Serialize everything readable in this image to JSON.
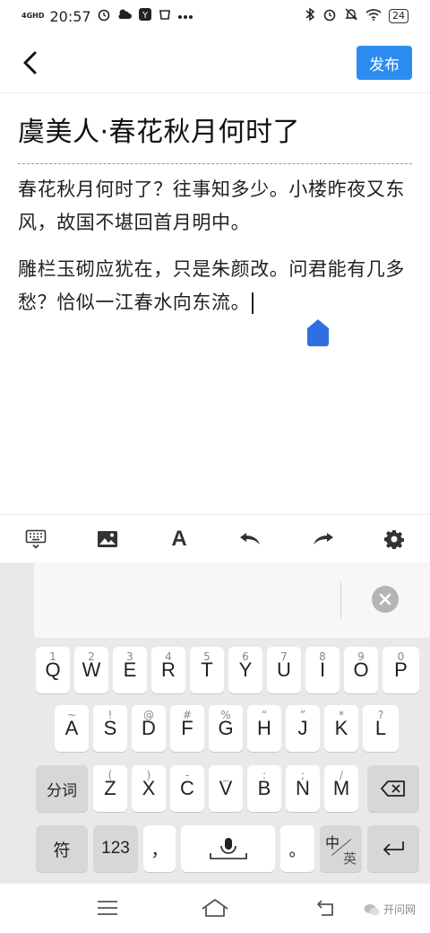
{
  "status_bar": {
    "network": "4GHD",
    "time": "20:57",
    "battery": "24"
  },
  "header": {
    "publish_label": "发布"
  },
  "editor": {
    "title": "虞美人·春花秋月何时了",
    "paragraphs": [
      "春花秋月何时了？往事知多少。小楼昨夜又东风，故国不堪回首月明中。",
      "雕栏玉砌应犹在，只是朱颜改。问君能有几多愁？恰似一江春水向东流。"
    ]
  },
  "toolbar": {
    "items": [
      "keyboard-toggle",
      "insert-image",
      "font-style",
      "undo",
      "redo",
      "settings"
    ],
    "font_label": "A"
  },
  "keyboard": {
    "row1": [
      {
        "main": "Q",
        "sub": "1"
      },
      {
        "main": "W",
        "sub": "2"
      },
      {
        "main": "E",
        "sub": "3"
      },
      {
        "main": "R",
        "sub": "4"
      },
      {
        "main": "T",
        "sub": "5"
      },
      {
        "main": "Y",
        "sub": "6"
      },
      {
        "main": "U",
        "sub": "7"
      },
      {
        "main": "I",
        "sub": "8"
      },
      {
        "main": "O",
        "sub": "9"
      },
      {
        "main": "P",
        "sub": "0"
      }
    ],
    "row2": [
      {
        "main": "A",
        "sub": "~"
      },
      {
        "main": "S",
        "sub": "!"
      },
      {
        "main": "D",
        "sub": "@"
      },
      {
        "main": "F",
        "sub": "#"
      },
      {
        "main": "G",
        "sub": "%"
      },
      {
        "main": "H",
        "sub": "“"
      },
      {
        "main": "J",
        "sub": "”"
      },
      {
        "main": "K",
        "sub": "*"
      },
      {
        "main": "L",
        "sub": "?"
      }
    ],
    "row3": [
      {
        "main": "Z",
        "sub": "("
      },
      {
        "main": "X",
        "sub": ")"
      },
      {
        "main": "C",
        "sub": "-"
      },
      {
        "main": "V",
        "sub": "_"
      },
      {
        "main": "B",
        "sub": ":"
      },
      {
        "main": "N",
        "sub": ";"
      },
      {
        "main": "M",
        "sub": "/"
      }
    ],
    "fenci_label": "分词",
    "symbol_label": "符",
    "num_label": "123",
    "comma_label": "，",
    "period_label": "。",
    "lang_zh": "中",
    "lang_en": "英",
    "colors": {
      "background": "#e9e9e9",
      "key": "#ffffff",
      "function_key": "#d7d7d7"
    }
  },
  "watermark": {
    "text": "开问网"
  },
  "colors": {
    "accent": "#2d8cf0",
    "cursor_handle": "#2f6fe0"
  }
}
